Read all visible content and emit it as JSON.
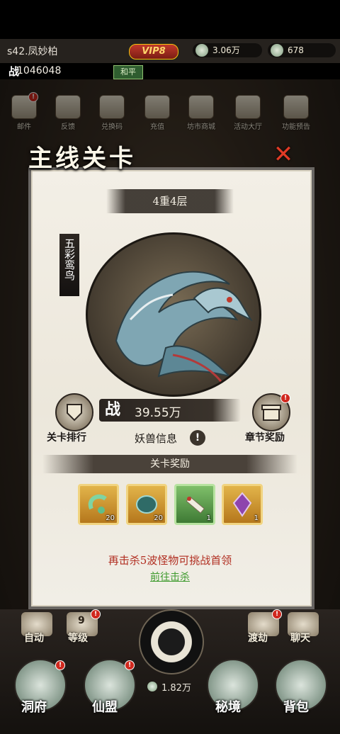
{
  "hud": {
    "server_name": "s42.凤妙柏",
    "vip": "VIP8",
    "currency1": "3.06万",
    "currency2": "678",
    "power_label": "战",
    "power": "1046048",
    "peace_mode": "和平"
  },
  "top_icons": [
    {
      "label": "邮件"
    },
    {
      "label": "反馈"
    },
    {
      "label": "兑换码"
    },
    {
      "label": "充值"
    },
    {
      "label": "坊市商城"
    },
    {
      "label": "活动大厅"
    },
    {
      "label": "功能预告"
    }
  ],
  "panel": {
    "title": "主线关卡",
    "floor": "4重4层",
    "monster_name": "五彩鸾鸟",
    "power_label": "战",
    "power": "39.55万",
    "rank_label": "关卡排行",
    "chapter_reward_label": "章节奖励",
    "beast_info": "妖兽信息",
    "beast_info_icon": "!",
    "reward_header": "关卡奖励",
    "rewards": [
      {
        "name": "jade-ring-icon",
        "count": "20"
      },
      {
        "name": "spirit-orb-icon",
        "count": "20"
      },
      {
        "name": "scroll-icon",
        "count": "1"
      },
      {
        "name": "purple-gem-icon",
        "count": "1"
      }
    ],
    "kill_message": "再击杀5波怪物可挑战首领",
    "go_kill": "前往击杀"
  },
  "bottom": {
    "auto": "自动",
    "level_num": "9",
    "level": "等级",
    "tribulation": "渡劫",
    "chat": "聊天",
    "cave": "洞府",
    "alliance": "仙盟",
    "realm": "秘境",
    "bag": "背包",
    "lingqi": "1.82万"
  },
  "colors": {
    "accent_red": "#b12d20",
    "link_green": "#3f9b2f",
    "panel_bg": "#f3efe6"
  }
}
